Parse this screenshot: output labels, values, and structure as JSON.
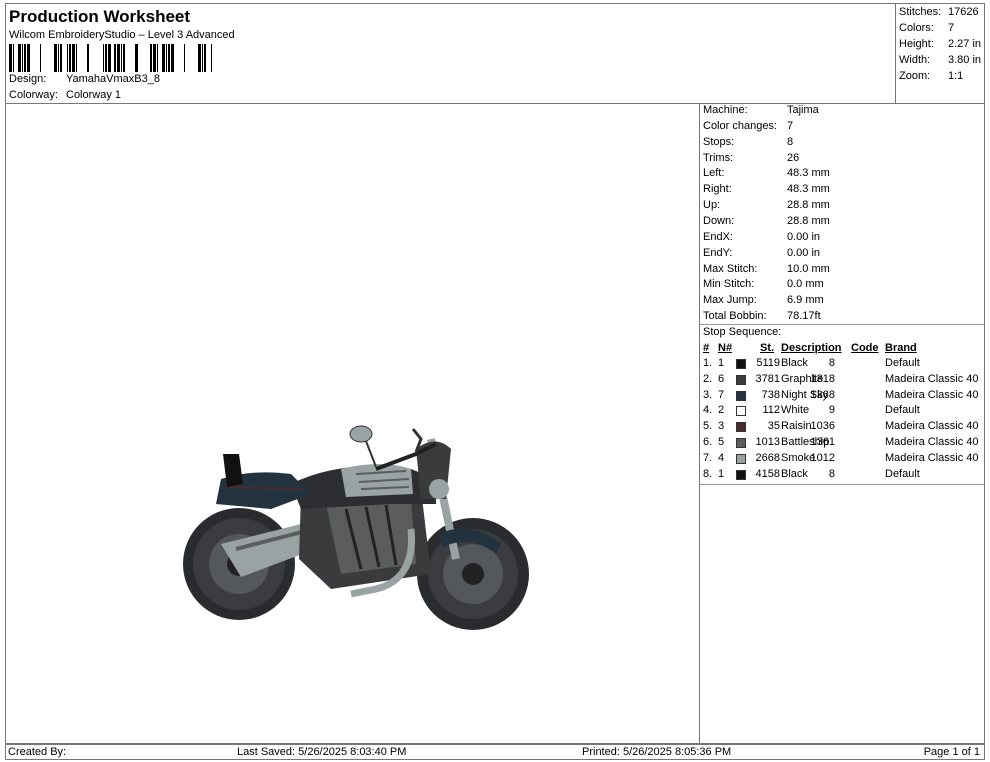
{
  "header": {
    "title": "Production Worksheet",
    "subtitle": "Wilcom EmbroideryStudio – Level 3 Advanced",
    "design_label": "Design:",
    "design_value": "YamahaVmaxB3_8",
    "colorway_label": "Colorway:",
    "colorway_value": "Colorway 1"
  },
  "summary": {
    "stitches_label": "Stitches:",
    "stitches": "17626",
    "colors_label": "Colors:",
    "colors": "7",
    "height_label": "Height:",
    "height": "2.27 in",
    "width_label": "Width:",
    "width": "3.80 in",
    "zoom_label": "Zoom:",
    "zoom": "1:1"
  },
  "details": [
    {
      "label": "Machine:",
      "value": "Tajima"
    },
    {
      "label": "Color changes:",
      "value": "7"
    },
    {
      "label": "Stops:",
      "value": "8"
    },
    {
      "label": "Trims:",
      "value": "26"
    },
    {
      "label": "Left:",
      "value": "48.3 mm"
    },
    {
      "label": "Right:",
      "value": "48.3 mm"
    },
    {
      "label": "Up:",
      "value": "28.8 mm"
    },
    {
      "label": "Down:",
      "value": "28.8 mm"
    },
    {
      "label": "EndX:",
      "value": "0.00 in"
    },
    {
      "label": "EndY:",
      "value": "0.00 in"
    },
    {
      "label": "Max Stitch:",
      "value": "10.0 mm"
    },
    {
      "label": "Min Stitch:",
      "value": "0.0 mm"
    },
    {
      "label": "Max Jump:",
      "value": "6.9 mm"
    },
    {
      "label": "Total Bobbin:",
      "value": "78.17ft"
    }
  ],
  "stop_sequence": {
    "title": "Stop Sequence:",
    "headers": {
      "num": "#",
      "n": "N#",
      "st": "St.",
      "description": "Description",
      "code": "Code",
      "brand": "Brand"
    },
    "rows": [
      {
        "num": "1.",
        "n": "1",
        "color": "#111111",
        "st": "5119",
        "description": "Black",
        "code": "8",
        "brand": "Default"
      },
      {
        "num": "2.",
        "n": "6",
        "color": "#3b3b3d",
        "st": "3781",
        "description": "Graphite",
        "code": "1318",
        "brand": "Madeira Classic 40"
      },
      {
        "num": "3.",
        "n": "7",
        "color": "#22323f",
        "st": "738",
        "description": "Night Sky",
        "code": "1368",
        "brand": "Madeira Classic 40"
      },
      {
        "num": "4.",
        "n": "2",
        "color": "#ffffff",
        "st": "112",
        "description": "White",
        "code": "9",
        "brand": "Default"
      },
      {
        "num": "5.",
        "n": "3",
        "color": "#4a2a2a",
        "st": "35",
        "description": "Raisin",
        "code": "1036",
        "brand": "Madeira Classic 40"
      },
      {
        "num": "6.",
        "n": "5",
        "color": "#5a5c5e",
        "st": "1013",
        "description": "Battleship",
        "code": "1361",
        "brand": "Madeira Classic 40"
      },
      {
        "num": "7.",
        "n": "4",
        "color": "#9aa3a3",
        "st": "2668",
        "description": "Smoke",
        "code": "1012",
        "brand": "Madeira Classic 40"
      },
      {
        "num": "8.",
        "n": "1",
        "color": "#111111",
        "st": "4158",
        "description": "Black",
        "code": "8",
        "brand": "Default"
      }
    ]
  },
  "footer": {
    "created_by": "Created By:",
    "last_saved": "Last Saved: 5/26/2025 8:03:40 PM",
    "printed": "Printed: 5/26/2025 8:05:36 PM",
    "page": "Page 1 of 1"
  }
}
